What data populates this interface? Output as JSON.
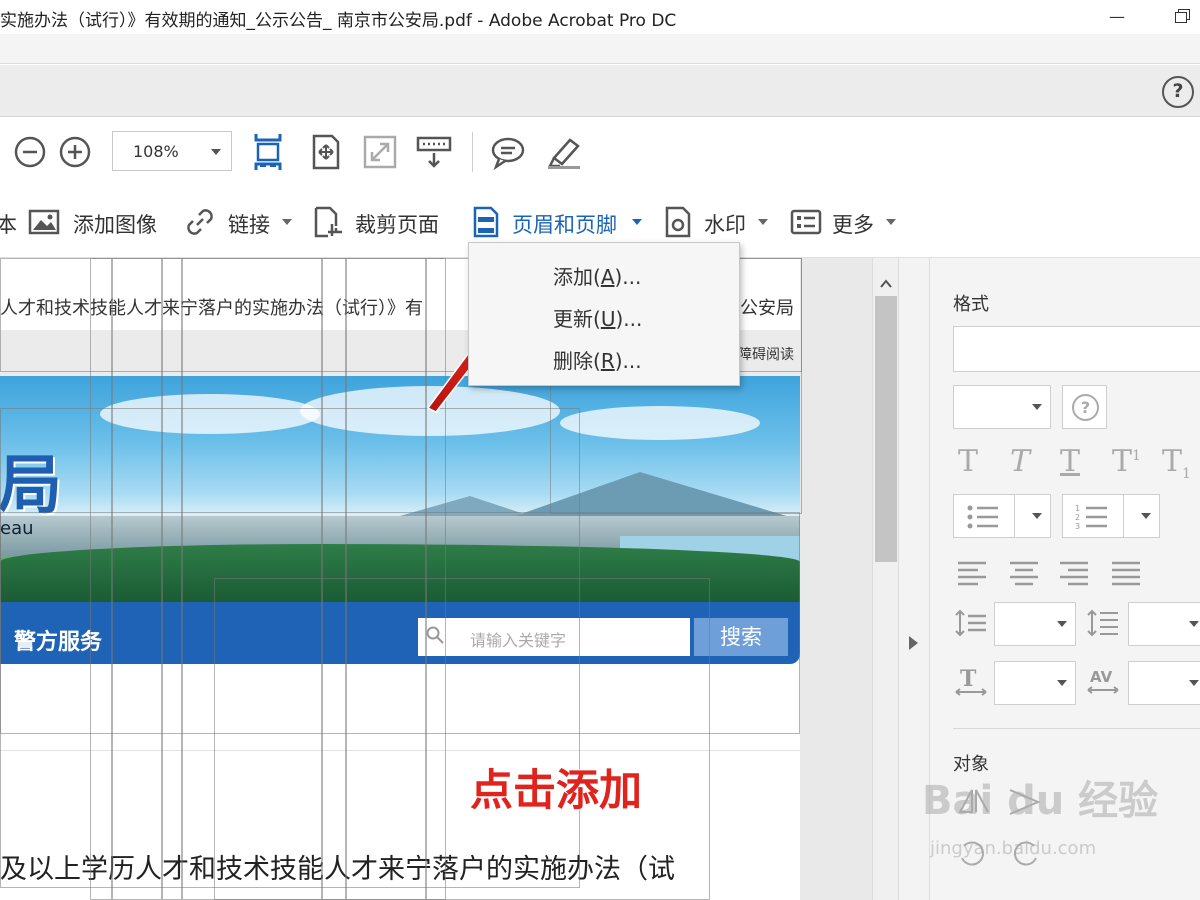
{
  "window": {
    "title": "实施办法（试行）》有效期的通知_公示公告_ 南京市公安局.pdf - Adobe Acrobat Pro DC",
    "minimize": "—"
  },
  "toolbar": {
    "zoom_value": "108%"
  },
  "help": {
    "label": "?"
  },
  "edit_tools": {
    "edge_char": "本",
    "add_image": "添加图像",
    "link": "链接",
    "crop": "裁剪页面",
    "header_footer": "页眉和页脚",
    "watermark": "水印",
    "more": "更多"
  },
  "dropdown": {
    "add": "添加",
    "add_key": "A",
    "update": "更新",
    "update_key": "U",
    "delete": "删除",
    "delete_key": "R",
    "paren_open": "(",
    "paren_close": ")...",
    "items": [
      "添加(A)...",
      "更新(U)...",
      "删除(R)..."
    ]
  },
  "document": {
    "header_line": "人才和技术技能人才来宁落户的实施办法（试行）》有",
    "header_right": "公安局",
    "accessibility": "障碍阅读",
    "banner_char": "局",
    "banner_eau": "eau",
    "nav_label": "警方服务",
    "search_placeholder": "请输入关键字",
    "search_button": "搜索",
    "body_line": "及以上学历人才和技术技能人才来宁落户的实施办法（试"
  },
  "annotation": {
    "text": "点击添加",
    "color": "#e0231d"
  },
  "right_panel": {
    "format_heading": "格式",
    "objects_heading": "对象",
    "question": "?",
    "text_styles": [
      "T",
      "T",
      "T",
      "T",
      "T"
    ],
    "superscript": "1",
    "subscript": "1",
    "av": "AV"
  },
  "watermark": {
    "brand": "Bai du 经验",
    "url": "jingyan.baidu.com"
  },
  "colors": {
    "accent_blue": "#1b63b5",
    "nav_blue": "#1e63b6",
    "annotation_red": "#e0231d"
  }
}
